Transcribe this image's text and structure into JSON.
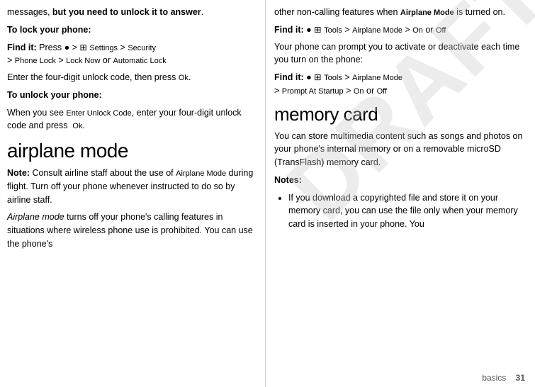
{
  "left": {
    "intro_text": "messages, ",
    "intro_bold": "but you need to unlock it to answer",
    "intro_end": ".",
    "lock_heading": "To lock your phone:",
    "lock_findit_prefix": "Find it:",
    "lock_findit_path": " Press ",
    "lock_findit_nav": "⬤ > ⊞ Settings > Security > Phone Lock > Lock Now",
    "lock_findit_or": " or ",
    "lock_findit_auto": "Automatic Lock",
    "lock_instruction": "Enter the four-digit unlock code, then press Ok.",
    "unlock_heading": "To unlock your phone:",
    "unlock_text_pre": "When you see ",
    "unlock_code_label": "Enter Unlock Code",
    "unlock_text_post": ", enter your four-digit unlock code and press  Ok.",
    "airplane_heading": "airplane mode",
    "note_label": "Note:",
    "note_text": " Consult airline staff about the use of ",
    "airplane_mode_inline": "Airplane Mode",
    "note_text2": " during flight. Turn off your phone whenever instructed to do so by airline staff.",
    "italic_text": "Airplane mode",
    "italic_rest": " turns off your phone's calling features in situations where wireless phone use is prohibited. You can use the phone's"
  },
  "right": {
    "other_text": "other non-calling features when ",
    "airplane_mode_inline": "Airplane Mode",
    "other_text2": " is turned on.",
    "findit1_prefix": "Find it:",
    "findit1_path": " ⬤ ⊞ Tools > Airplane Mode > On",
    "findit1_or": " or ",
    "findit1_off": "Off",
    "prompt_text": "Your phone can prompt you to activate or deactivate each time you turn on the phone:",
    "findit2_prefix": "Find it:",
    "findit2_path": " ⬤ ⊞ Tools > Airplane Mode > Prompt At Startup > On",
    "findit2_or": " or ",
    "findit2_off": "Off",
    "memory_heading": "memory card",
    "memory_text": "You can store multimedia content such as songs and photos on your phone's internal memory or on a removable microSD (TransFlash) memory card.",
    "notes_label": "Notes:",
    "bullet1": "If you download a copyrighted file and store it on your memory card, you can use the file only when your memory card is inserted in your phone. You",
    "footer_label": "basics",
    "footer_page": "31"
  }
}
